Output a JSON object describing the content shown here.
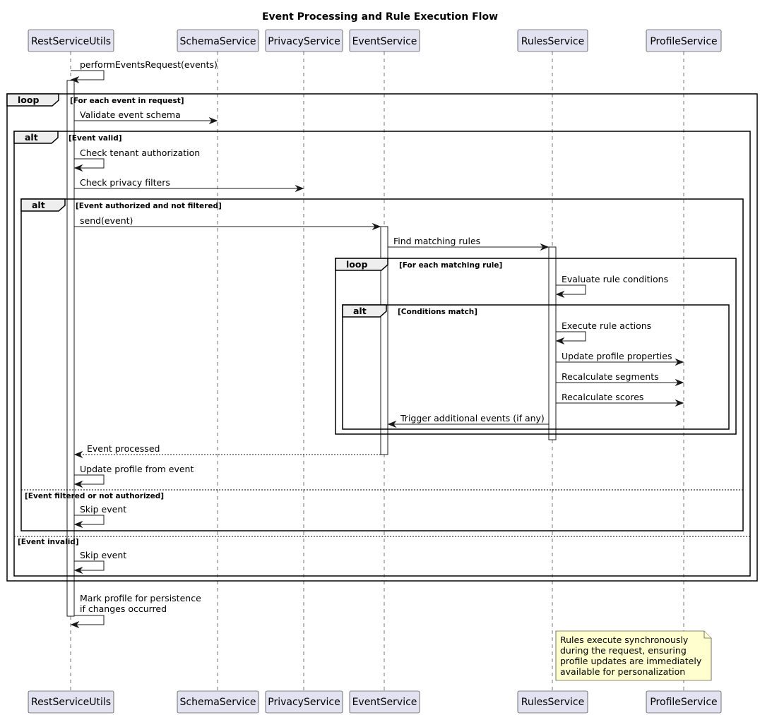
{
  "title": "Event Processing and Rule Execution Flow",
  "participants": [
    "RestServiceUtils",
    "SchemaService",
    "PrivacyService",
    "EventService",
    "RulesService",
    "ProfileService"
  ],
  "messages": [
    {
      "label": "performEventsRequest(events)",
      "kind": "self"
    },
    {
      "label": "Validate event schema",
      "kind": "call"
    },
    {
      "label": "Check tenant authorization",
      "kind": "self"
    },
    {
      "label": "Check privacy filters",
      "kind": "call"
    },
    {
      "label": "send(event)",
      "kind": "call"
    },
    {
      "label": "Find matching rules",
      "kind": "call"
    },
    {
      "label": "Evaluate rule conditions",
      "kind": "self"
    },
    {
      "label": "Execute rule actions",
      "kind": "self"
    },
    {
      "label": "Update profile properties",
      "kind": "call"
    },
    {
      "label": "Recalculate segments",
      "kind": "call"
    },
    {
      "label": "Recalculate scores",
      "kind": "call"
    },
    {
      "label": "Trigger additional events (if any)",
      "kind": "call"
    },
    {
      "label": "Event processed",
      "kind": "return"
    },
    {
      "label": "Update profile from event",
      "kind": "self"
    },
    {
      "label": "Skip event",
      "kind": "self"
    },
    {
      "label": "Skip event",
      "kind": "self"
    },
    {
      "label": [
        "Mark profile for persistence",
        "if changes occurred"
      ],
      "kind": "self"
    }
  ],
  "fragments": [
    {
      "keyword": "loop",
      "guard": "[For each event in request]"
    },
    {
      "keyword": "alt",
      "guard": "[Event valid]",
      "else_guard": "[Event invalid]"
    },
    {
      "keyword": "alt",
      "guard": "[Event authorized and not filtered]",
      "else_guard": "[Event filtered or not authorized]"
    },
    {
      "keyword": "loop",
      "guard": "[For each matching rule]"
    },
    {
      "keyword": "alt",
      "guard": "[Conditions match]"
    }
  ],
  "note": {
    "lines": [
      "Rules execute synchronously",
      "during the request, ensuring",
      "profile updates are immediately",
      "available for personalization"
    ]
  },
  "colors": {
    "participant_fill": "#e2e2f0",
    "note_fill": "#fefece",
    "fragment_tab": "#eeeeee",
    "line": "#181818"
  }
}
